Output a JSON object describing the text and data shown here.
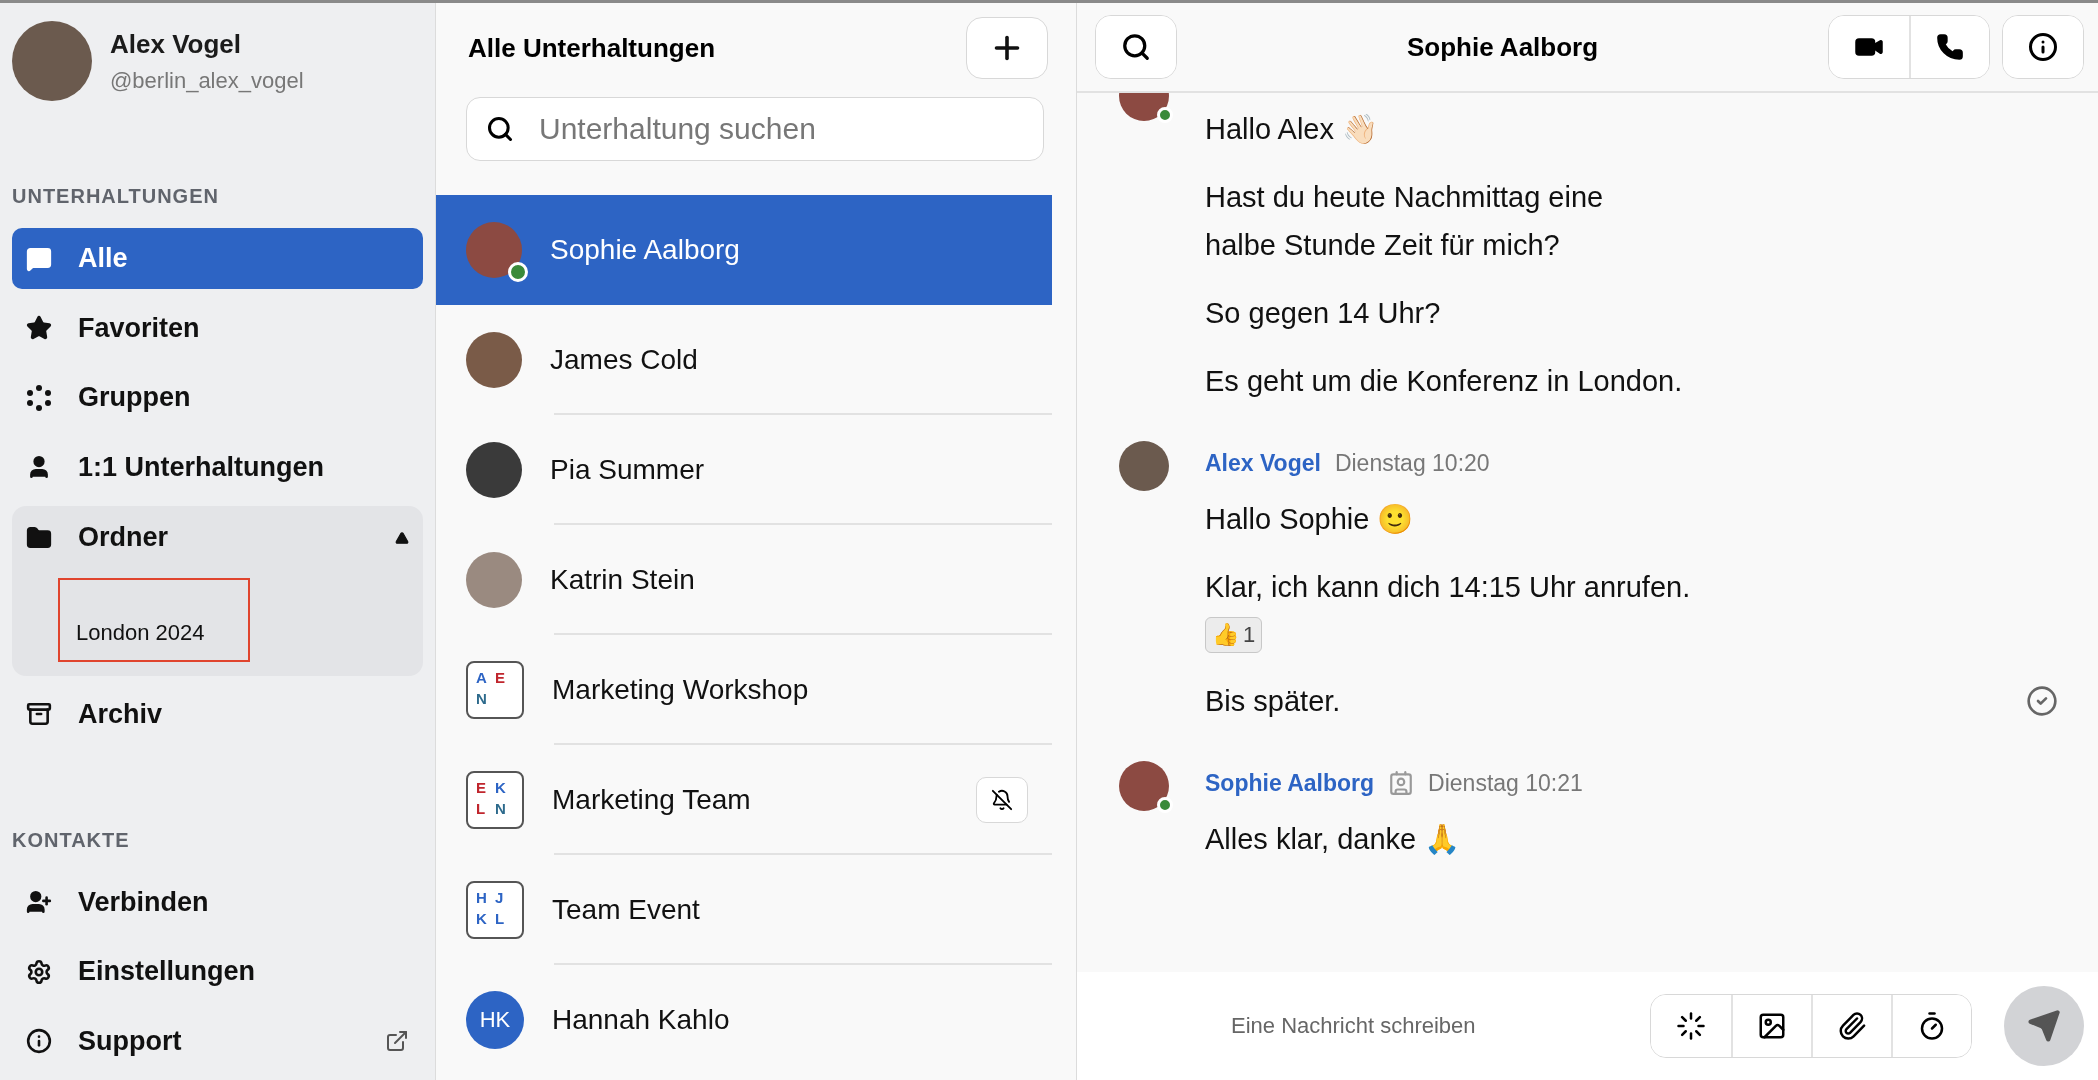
{
  "profile": {
    "name": "Alex Vogel",
    "handle": "@berlin_alex_vogel"
  },
  "sidebar": {
    "sections": [
      {
        "title": "UNTERHALTUNGEN",
        "items": [
          {
            "label": "Alle",
            "selected": true
          },
          {
            "label": "Favoriten",
            "selected": false
          },
          {
            "label": "Gruppen",
            "selected": false
          },
          {
            "label": "1:1 Unterhaltungen",
            "selected": false
          },
          {
            "label": "Ordner",
            "selected": false,
            "expanded": true,
            "children": [
              {
                "label": "London 2024",
                "highlighted": true
              }
            ]
          },
          {
            "label": "Archiv",
            "selected": false
          }
        ]
      },
      {
        "title": "KONTAKTE",
        "items": [
          {
            "label": "Verbinden",
            "selected": false
          },
          {
            "label": "Einstellungen",
            "selected": false
          },
          {
            "label": "Support",
            "selected": false,
            "external": true
          }
        ]
      }
    ]
  },
  "conversations": {
    "title": "Alle Unterhaltungen",
    "search": {
      "placeholder": "Unterhaltung suchen"
    },
    "items": [
      {
        "name": "Sophie Aalborg",
        "kind": "photo",
        "selected": true,
        "online": true,
        "muted": false
      },
      {
        "name": "James Cold",
        "kind": "photo",
        "selected": false,
        "online": false,
        "muted": false
      },
      {
        "name": "Pia Summer",
        "kind": "photo",
        "selected": false,
        "online": false,
        "muted": false
      },
      {
        "name": "Katrin Stein",
        "kind": "photo",
        "selected": false,
        "online": false,
        "muted": false
      },
      {
        "name": "Marketing Workshop",
        "kind": "group",
        "selected": false,
        "online": false,
        "muted": false,
        "letters": [
          {
            "text": "A",
            "color": "#2d64c4"
          },
          {
            "text": "E",
            "color": "#c0262d"
          },
          {
            "text": "N",
            "color": "#2d6a8c"
          }
        ]
      },
      {
        "name": "Marketing Team",
        "kind": "group",
        "selected": false,
        "online": false,
        "muted": true,
        "letters": [
          {
            "text": "E",
            "color": "#c0262d"
          },
          {
            "text": "K",
            "color": "#2d64c4"
          },
          {
            "text": "L",
            "color": "#c0262d"
          },
          {
            "text": "N",
            "color": "#2d6a8c"
          }
        ]
      },
      {
        "name": "Team Event",
        "kind": "group",
        "selected": false,
        "online": false,
        "muted": false,
        "letters": [
          {
            "text": "H",
            "color": "#2d64c4"
          },
          {
            "text": "J",
            "color": "#2d64c4"
          },
          {
            "text": "K",
            "color": "#2d64c4"
          },
          {
            "text": "L",
            "color": "#2d64c4"
          }
        ]
      },
      {
        "name": "Hannah Kahlo",
        "kind": "initials",
        "initials": "HK",
        "selected": false,
        "online": false,
        "muted": false
      }
    ]
  },
  "chat": {
    "title": "Sophie Aalborg",
    "groups": [
      {
        "partial": true,
        "online": true,
        "messages": [
          {
            "text": "Hallo Alex 👋🏻"
          },
          {
            "text": "Hast du heute Nachmittag eine\nhalbe Stunde Zeit für mich?"
          },
          {
            "text": "So gegen 14 Uhr?"
          },
          {
            "text": "Es geht um die Konferenz in London."
          }
        ]
      },
      {
        "author": "Alex Vogel",
        "time": "Dienstag 10:20",
        "online": false,
        "badge": false,
        "messages": [
          {
            "text": "Hallo Sophie 🙂"
          },
          {
            "text": "Klar, ich kann dich 14:15 Uhr anrufen.",
            "reaction": {
              "emoji": "👍",
              "count": "1"
            }
          },
          {
            "text": "Bis später.",
            "read": true
          }
        ]
      },
      {
        "author": "Sophie Aalborg",
        "time": "Dienstag 10:21",
        "online": true,
        "badge": true,
        "messages": [
          {
            "text": "Alles klar, danke 🙏"
          }
        ]
      }
    ],
    "composer": {
      "placeholder": "Eine Nachricht schreiben"
    }
  }
}
